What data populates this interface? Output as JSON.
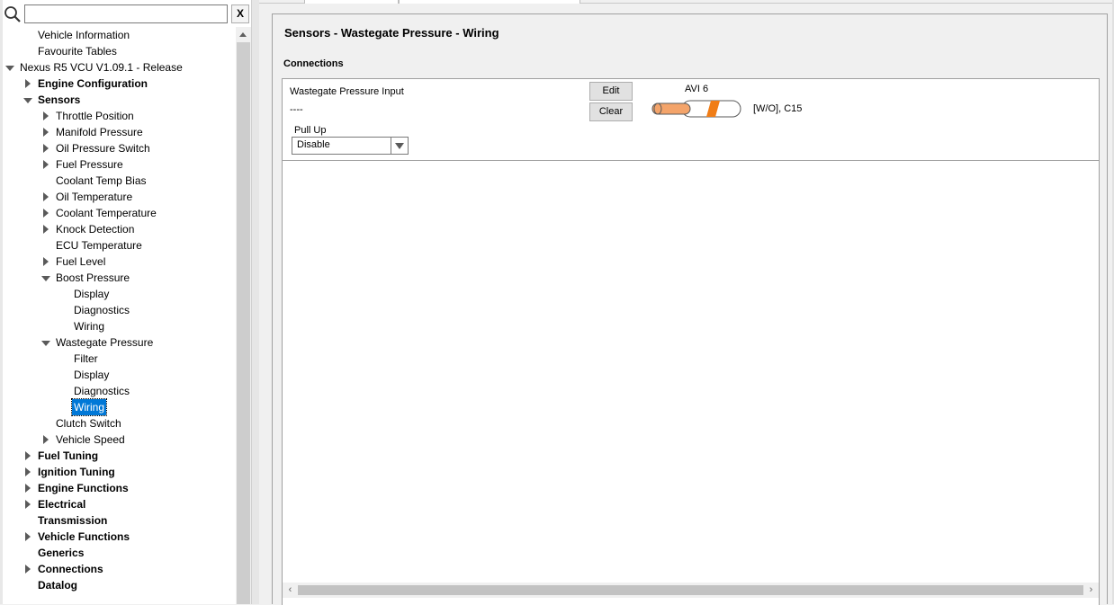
{
  "search": {
    "placeholder": "",
    "value": "",
    "clear_label": "X"
  },
  "tree": [
    {
      "label": "Vehicle Information",
      "level": 1,
      "toggle": "none",
      "bold": false,
      "selected": false
    },
    {
      "label": "Favourite Tables",
      "level": 1,
      "toggle": "none",
      "bold": false,
      "selected": false
    },
    {
      "label": "Nexus R5 VCU V1.09.1 - Release",
      "level": 0,
      "toggle": "expanded",
      "bold": false,
      "selected": false
    },
    {
      "label": "Engine Configuration",
      "level": 1,
      "toggle": "collapsed",
      "bold": true,
      "selected": false
    },
    {
      "label": "Sensors",
      "level": 1,
      "toggle": "expanded",
      "bold": true,
      "selected": false
    },
    {
      "label": "Throttle Position",
      "level": 2,
      "toggle": "collapsed",
      "bold": false,
      "selected": false
    },
    {
      "label": "Manifold Pressure",
      "level": 2,
      "toggle": "collapsed",
      "bold": false,
      "selected": false
    },
    {
      "label": "Oil Pressure Switch",
      "level": 2,
      "toggle": "collapsed",
      "bold": false,
      "selected": false
    },
    {
      "label": "Fuel Pressure",
      "level": 2,
      "toggle": "collapsed",
      "bold": false,
      "selected": false
    },
    {
      "label": "Coolant Temp Bias",
      "level": 2,
      "toggle": "none",
      "bold": false,
      "selected": false
    },
    {
      "label": "Oil Temperature",
      "level": 2,
      "toggle": "collapsed",
      "bold": false,
      "selected": false
    },
    {
      "label": "Coolant Temperature",
      "level": 2,
      "toggle": "collapsed",
      "bold": false,
      "selected": false
    },
    {
      "label": "Knock Detection",
      "level": 2,
      "toggle": "collapsed",
      "bold": false,
      "selected": false
    },
    {
      "label": "ECU Temperature",
      "level": 2,
      "toggle": "none",
      "bold": false,
      "selected": false
    },
    {
      "label": "Fuel Level",
      "level": 2,
      "toggle": "collapsed",
      "bold": false,
      "selected": false
    },
    {
      "label": "Boost Pressure",
      "level": 2,
      "toggle": "expanded",
      "bold": false,
      "selected": false
    },
    {
      "label": "Display",
      "level": 3,
      "toggle": "none",
      "bold": false,
      "selected": false
    },
    {
      "label": "Diagnostics",
      "level": 3,
      "toggle": "none",
      "bold": false,
      "selected": false
    },
    {
      "label": "Wiring",
      "level": 3,
      "toggle": "none",
      "bold": false,
      "selected": false
    },
    {
      "label": "Wastegate Pressure",
      "level": 2,
      "toggle": "expanded",
      "bold": false,
      "selected": false
    },
    {
      "label": "Filter",
      "level": 3,
      "toggle": "none",
      "bold": false,
      "selected": false
    },
    {
      "label": "Display",
      "level": 3,
      "toggle": "none",
      "bold": false,
      "selected": false
    },
    {
      "label": "Diagnostics",
      "level": 3,
      "toggle": "none",
      "bold": false,
      "selected": false
    },
    {
      "label": "Wiring",
      "level": 3,
      "toggle": "none",
      "bold": false,
      "selected": true
    },
    {
      "label": "Clutch Switch",
      "level": 2,
      "toggle": "none",
      "bold": false,
      "selected": false
    },
    {
      "label": "Vehicle Speed",
      "level": 2,
      "toggle": "collapsed",
      "bold": false,
      "selected": false
    },
    {
      "label": "Fuel Tuning",
      "level": 1,
      "toggle": "collapsed",
      "bold": true,
      "selected": false
    },
    {
      "label": "Ignition Tuning",
      "level": 1,
      "toggle": "collapsed",
      "bold": true,
      "selected": false
    },
    {
      "label": "Engine Functions",
      "level": 1,
      "toggle": "collapsed",
      "bold": true,
      "selected": false
    },
    {
      "label": "Electrical",
      "level": 1,
      "toggle": "collapsed",
      "bold": true,
      "selected": false
    },
    {
      "label": "Transmission",
      "level": 1,
      "toggle": "none",
      "bold": true,
      "selected": false
    },
    {
      "label": "Vehicle Functions",
      "level": 1,
      "toggle": "collapsed",
      "bold": true,
      "selected": false
    },
    {
      "label": "Generics",
      "level": 1,
      "toggle": "none",
      "bold": true,
      "selected": false
    },
    {
      "label": "Connections",
      "level": 1,
      "toggle": "collapsed",
      "bold": true,
      "selected": false
    },
    {
      "label": "Datalog",
      "level": 1,
      "toggle": "none",
      "bold": true,
      "selected": false
    }
  ],
  "panel": {
    "title": "Sensors - Wastegate Pressure - Wiring",
    "section_heading": "Connections",
    "input_label": "Wastegate Pressure Input",
    "input_value": "----",
    "edit_label": "Edit",
    "clear_label": "Clear",
    "avi_label": "AVI 6",
    "pin_label": "[W/O], C15",
    "pullup_label": "Pull Up",
    "pullup_value": "Disable",
    "wire_colors": {
      "base": "#f4a46a",
      "stripe": "#f07d16",
      "outline": "#5a5a5a"
    }
  },
  "icons": {
    "search": "search-icon",
    "scroll_left": "‹",
    "scroll_right": "›"
  },
  "colors": {
    "selection": "#0078d7",
    "accent_wire": "#f07d16"
  }
}
